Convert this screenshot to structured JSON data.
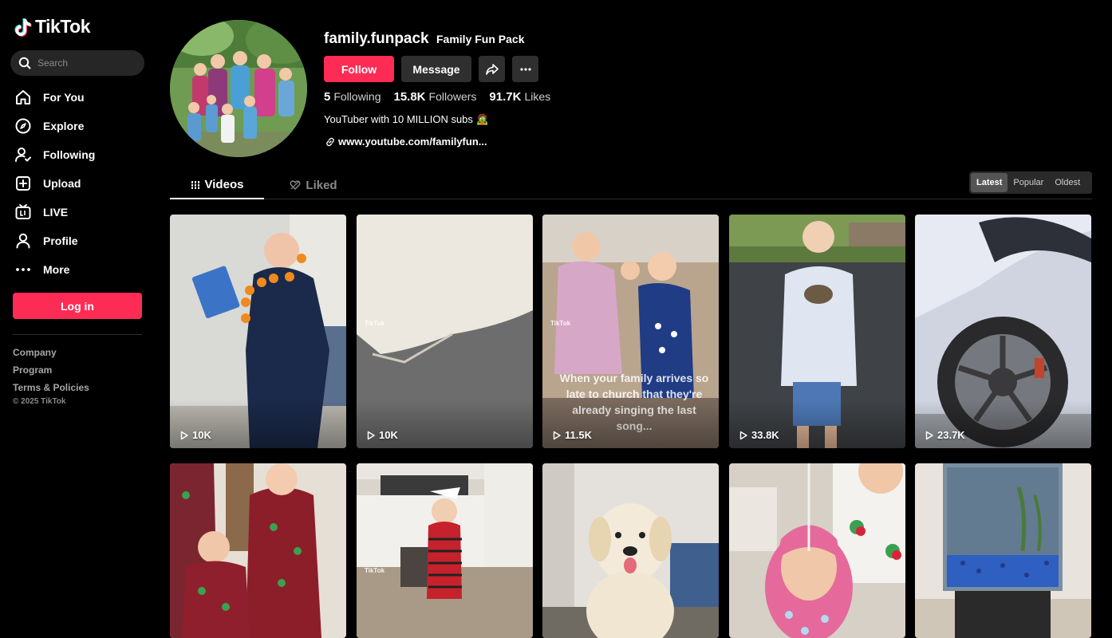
{
  "app": {
    "name": "TikTok"
  },
  "sidebar": {
    "search_placeholder": "Search",
    "items": [
      {
        "label": "For You",
        "icon": "home-icon"
      },
      {
        "label": "Explore",
        "icon": "compass-icon"
      },
      {
        "label": "Following",
        "icon": "following-icon"
      },
      {
        "label": "Upload",
        "icon": "upload-icon"
      },
      {
        "label": "LIVE",
        "icon": "live-icon"
      },
      {
        "label": "Profile",
        "icon": "profile-icon"
      },
      {
        "label": "More",
        "icon": "more-icon"
      }
    ],
    "login_label": "Log in",
    "footer_links": [
      "Company",
      "Program",
      "Terms & Policies"
    ],
    "copyright": "© 2025 TikTok"
  },
  "profile": {
    "username": "family.funpack",
    "nickname": "Family Fun Pack",
    "follow_label": "Follow",
    "message_label": "Message",
    "stats": [
      {
        "value": "5",
        "label": "Following"
      },
      {
        "value": "15.8K",
        "label": "Followers"
      },
      {
        "value": "91.7K",
        "label": "Likes"
      }
    ],
    "bio": "YouTuber with 10 MILLION subs 🧟",
    "link": "www.youtube.com/familyfun..."
  },
  "tabs": [
    {
      "label": "Videos",
      "active": true
    },
    {
      "label": "Liked",
      "active": false
    }
  ],
  "sort_options": [
    {
      "label": "Latest",
      "active": true
    },
    {
      "label": "Popular",
      "active": false
    },
    {
      "label": "Oldest",
      "active": false
    }
  ],
  "videos": [
    {
      "views": "10K"
    },
    {
      "views": "10K",
      "watermark": "TikTok"
    },
    {
      "views": "11.5K",
      "watermark": "TikTok",
      "caption": "When your family arrives so late to church that they're already singing the last song..."
    },
    {
      "views": "33.8K"
    },
    {
      "views": "23.7K"
    },
    {
      "views": ""
    },
    {
      "views": "",
      "watermark": "TikTok"
    },
    {
      "views": ""
    },
    {
      "views": ""
    },
    {
      "views": ""
    }
  ],
  "colors": {
    "accent": "#fe2c55",
    "background": "#000000",
    "button_dark": "#2f2f2f"
  }
}
